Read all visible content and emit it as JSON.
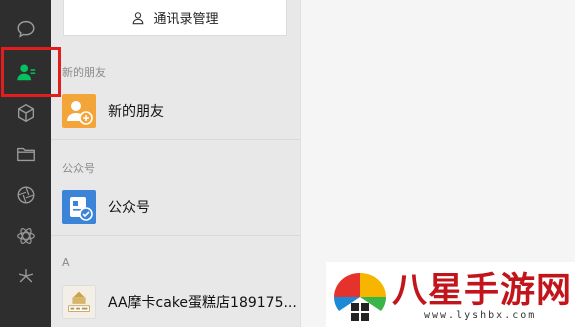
{
  "rail": {
    "items": [
      {
        "name": "chat",
        "icon": "chat-bubble-icon"
      },
      {
        "name": "contacts",
        "icon": "contacts-icon",
        "active": true
      },
      {
        "name": "favorites",
        "icon": "cube-icon"
      },
      {
        "name": "files",
        "icon": "folder-icon"
      },
      {
        "name": "moments",
        "icon": "aperture-icon"
      },
      {
        "name": "mini-programs",
        "icon": "atom-icon"
      },
      {
        "name": "channels",
        "icon": "sparkle-icon"
      }
    ],
    "active_color": "#07c160",
    "highlight_color": "#e21d1d"
  },
  "panel": {
    "manage_button": "通讯录管理",
    "sections": [
      {
        "label": "新的朋友",
        "items": [
          {
            "name": "新的朋友",
            "icon": "new-friend-icon",
            "color": "#f4a53a"
          }
        ]
      },
      {
        "label": "公众号",
        "items": [
          {
            "name": "公众号",
            "icon": "official-account-icon",
            "color": "#3b84d8"
          }
        ]
      },
      {
        "label": "A",
        "items": [
          {
            "name": "AA摩卡cake蛋糕店189175...",
            "icon": "cake-shop-avatar"
          }
        ]
      }
    ]
  },
  "watermark": {
    "title": "八星手游网",
    "url": "www.lyshbx.com"
  }
}
